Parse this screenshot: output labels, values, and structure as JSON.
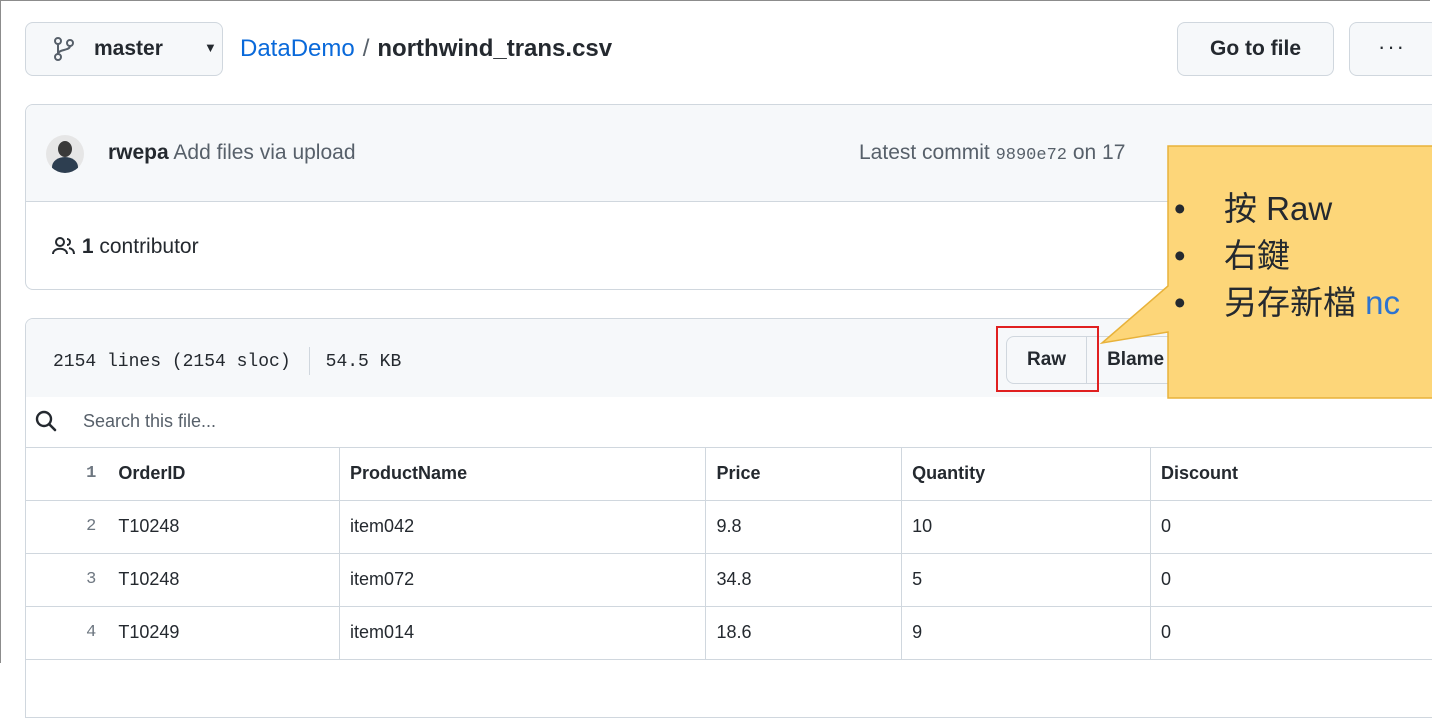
{
  "repo_header": {
    "branch": "master",
    "repo_name": "DataDemo",
    "separator": "/",
    "file_name": "northwind_trans.csv",
    "go_to_file_label": "Go to file",
    "more_label": "···"
  },
  "commit": {
    "author": "rwepa",
    "message": "Add files via upload",
    "latest_prefix": "Latest commit",
    "sha": "9890e72",
    "date_visible": "on 17",
    "contributor_count": "1",
    "contributor_label": "contributor"
  },
  "file_header": {
    "lines": "2154 lines (2154 sloc)",
    "size": "54.5 KB",
    "raw_label": "Raw",
    "blame_label": "Blame"
  },
  "search": {
    "placeholder": "Search this file..."
  },
  "table": {
    "rows": [
      {
        "line": "1",
        "cells": [
          "OrderID",
          "ProductName",
          "Price",
          "Quantity",
          "Discount"
        ]
      },
      {
        "line": "2",
        "cells": [
          "T10248",
          "item042",
          "9.8",
          "10",
          "0"
        ]
      },
      {
        "line": "3",
        "cells": [
          "T10248",
          "item072",
          "34.8",
          "5",
          "0"
        ]
      },
      {
        "line": "4",
        "cells": [
          "T10249",
          "item014",
          "18.6",
          "9",
          "0"
        ]
      }
    ]
  },
  "callout": {
    "items": [
      "按 Raw",
      "右鍵",
      "另存新檔"
    ],
    "partial_link": "nc",
    "fill_color": "#fdd679",
    "border_color": "#e8b23a",
    "highlight_color": "#e02020"
  }
}
